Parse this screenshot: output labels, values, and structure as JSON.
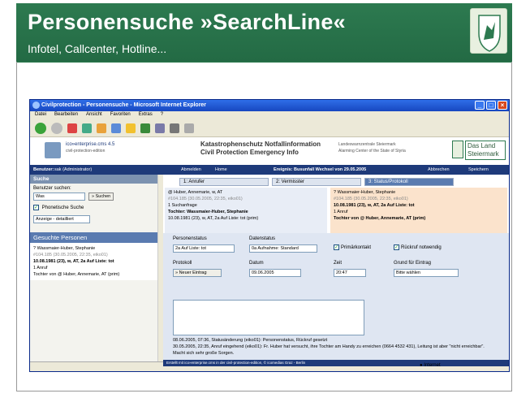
{
  "slide": {
    "title": "Personensuche »SearchLine«",
    "subtitle": "Infotel, Callcenter, Hotline..."
  },
  "window": {
    "title": "Civilprotection - Personensuche - Microsoft Internet Explorer",
    "menu": [
      "Datei",
      "Bearbeiten",
      "Ansicht",
      "Favoriten",
      "Extras",
      "?"
    ],
    "status_text": "Internet"
  },
  "app": {
    "product": "ico»enterprise.cms 4.5",
    "edition": "civil-protection-edition",
    "heading": "Katastrophenschutz Notfallinformation",
    "heading_en": "Civil Protection Emergency Info",
    "center_de": "Landeswarnzentrale Steiermark",
    "center_en": "Alarming Center of the State of Styria",
    "state": "Das Land Steiermark",
    "user_label": "Benutzer:",
    "user": "sak (Administrator)",
    "abmelden": "Abmelden",
    "home": "Home",
    "event": "Ereignis: Busunfall Wechsel von 29.05.2005",
    "abbrechen": "Abbrechen",
    "speichern": "Speichern"
  },
  "side": {
    "header": "Suche",
    "search_label": "Benutzer suchen:",
    "search_value": "Was",
    "search_button": "» Suchen",
    "phonetic": "Phonetische Suche",
    "display": "Anzeige - detailliert",
    "results_header": "Gesuchte Personen",
    "result": {
      "name": "? Wassmaier-Huber, Stephanie",
      "id": "#104.185 (30.05.2005, 22:35, eiko01)",
      "info": "10.08.1981 (23), w, AT, 2a Auf Liste: tot",
      "calls": "1 Anruf",
      "child": "Tochter von @ Huber, Annemarie, AT (prim)"
    }
  },
  "tabs": [
    "1: Anrufer",
    "2: Vermisster",
    "3: Status/Protokoll"
  ],
  "caller": {
    "name": "@ Huber, Annemarie, w, AT",
    "id": "#104.185 (30.05.2005, 22:35, eiko01)",
    "query": "1 Suchanfrage",
    "rel": "Tochter: Wassmaier-Huber, Stephanie",
    "info": "10.08.1981 (23), w, AT, 2a Auf Liste: tot (prim)"
  },
  "missing": {
    "name": "? Wassmaier-Huber, Stephanie",
    "id": "#104.185 (30.05.2005, 22:35, eiko01)",
    "info": "10.08.1981 (23), w, AT, 2a Auf Liste: tot",
    "calls": "1 Anruf",
    "rel": "Tochter von @ Huber, Annemarie, AT (prim)"
  },
  "form": {
    "personenstatus_label": "Personenstatus",
    "personenstatus": "2a Auf Liste: tot",
    "datenstatus_label": "Datenstatus",
    "datenstatus": "0a Aufnahme: Standard",
    "primaerkontakt": "Primärkontakt",
    "rueckruf": "Rückruf notwendig",
    "protokoll_label": "Protokoll",
    "neuer_eintrag": "» Neuer Eintrag",
    "datum_label": "Datum",
    "datum": "09.06.2005",
    "zeit_label": "Zeit",
    "zeit": "20:47",
    "grund_label": "Grund für Eintrag",
    "grund": "Bitte wählen"
  },
  "log": [
    "08.06.2005, 07:36, Statusänderung (eiko01): Personenstatus, Rückruf gesetzt",
    "30.05.2005, 22:35, Anruf eingehend (eiko01): Fr. Huber hat versucht, ihre Tochter am Handy zu erreichen (0664 4532 431), Leitung ist aber \"nicht erreichbar\". Macht sich sehr große Sorgen."
  ],
  "footer": "Erstellt mit ico»enterprise.cms in der civil-protection-edition, © icomedias Graz - Berlin"
}
